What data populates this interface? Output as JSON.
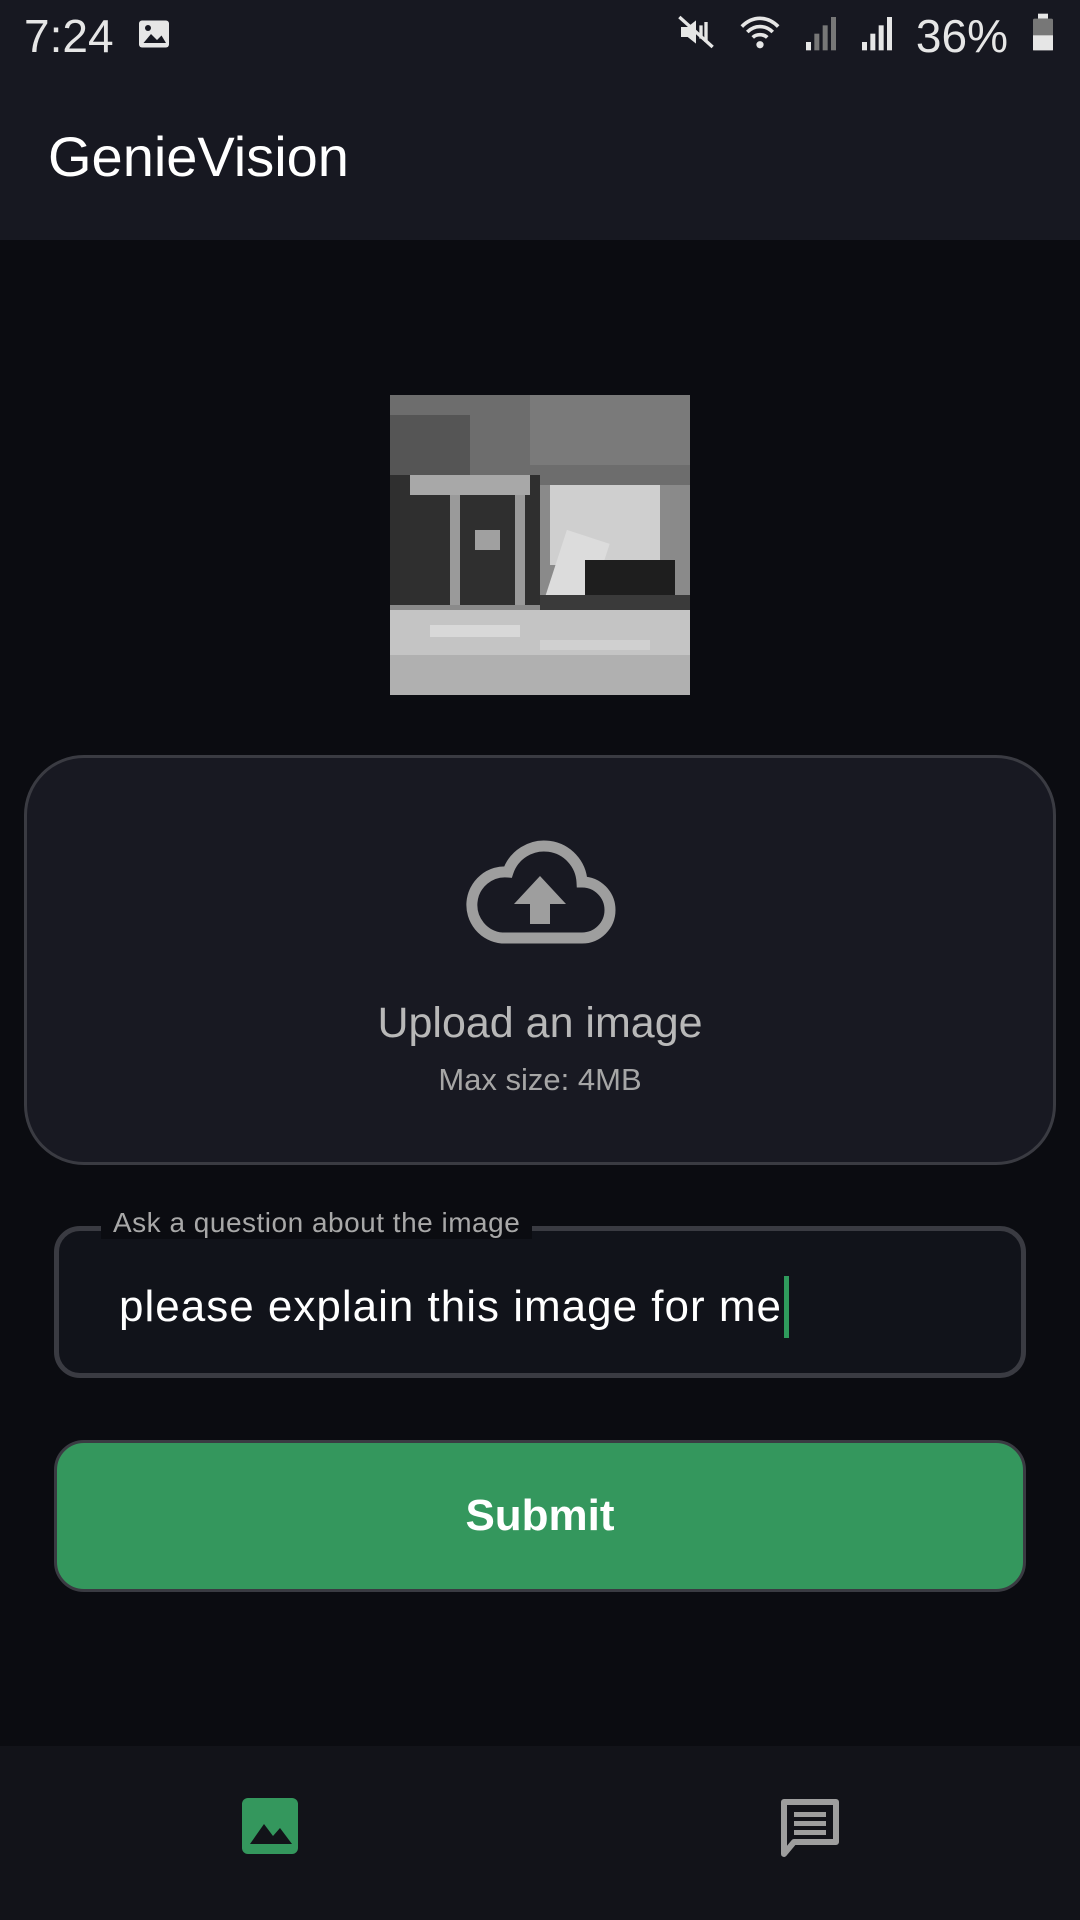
{
  "status_bar": {
    "time": "7:24",
    "battery_percent": "36%",
    "icons": [
      "image-notification-icon",
      "mute-icon",
      "wifi-icon",
      "signal-icon",
      "signal-icon",
      "battery-icon"
    ]
  },
  "app": {
    "title": "GenieVision"
  },
  "preview": {
    "icon": "uploaded-image-thumbnail"
  },
  "upload": {
    "icon": "cloud-upload-icon",
    "title": "Upload an image",
    "subtitle": "Max size: 4MB"
  },
  "question": {
    "label": "Ask a question about the image",
    "value": "please explain this image for me"
  },
  "submit": {
    "label": "Submit"
  },
  "bottom_nav": {
    "items": [
      {
        "icon": "image-icon",
        "active": true
      },
      {
        "icon": "chat-icon",
        "active": false
      }
    ]
  },
  "colors": {
    "accent": "#34975d",
    "background": "#0b0c11",
    "surface": "#171821"
  }
}
